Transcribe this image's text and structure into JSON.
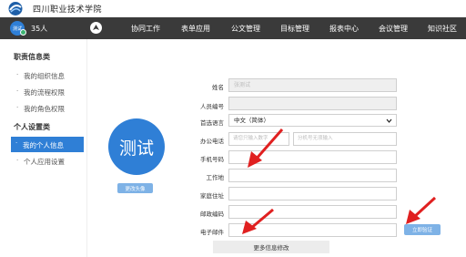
{
  "header": {
    "school_name": "四川职业技术学院"
  },
  "nav": {
    "avatar_text": "测试",
    "user_count": "35人",
    "items": [
      "协同工作",
      "表单应用",
      "公文管理",
      "目标管理",
      "报表中心",
      "会议管理",
      "知识社区"
    ]
  },
  "sidebar": {
    "groups": [
      {
        "title": "职责信息类",
        "items": [
          "我的组织信息",
          "我的流程权限",
          "我的角色权限"
        ]
      },
      {
        "title": "个人设置类",
        "items": [
          "我的个人信息",
          "个人应用设置"
        ]
      }
    ],
    "active_item": "我的个人信息"
  },
  "profile": {
    "avatar_text": "测试",
    "change_avatar_label": "更改头像"
  },
  "form": {
    "labels": {
      "name": "姓名",
      "staff_no": "人员编号",
      "language": "首选语言",
      "office_phone": "办公电话",
      "mobile": "手机号码",
      "work_place": "工作地",
      "home_address": "家庭住址",
      "postal_code": "邮政编码",
      "email": "电子邮件"
    },
    "values": {
      "name": "张测试",
      "staff_no": "",
      "language": "中文（简体）"
    },
    "placeholders": {
      "office_phone_a": "请您只输入数字",
      "office_phone_b": "分机号无须输入"
    },
    "verify_label": "立即验证",
    "more_label": "更多信息修改"
  },
  "colors": {
    "accent": "#2f7fd6",
    "nav_bg": "#3a3a3a",
    "annotation_arrow": "#e02020"
  }
}
